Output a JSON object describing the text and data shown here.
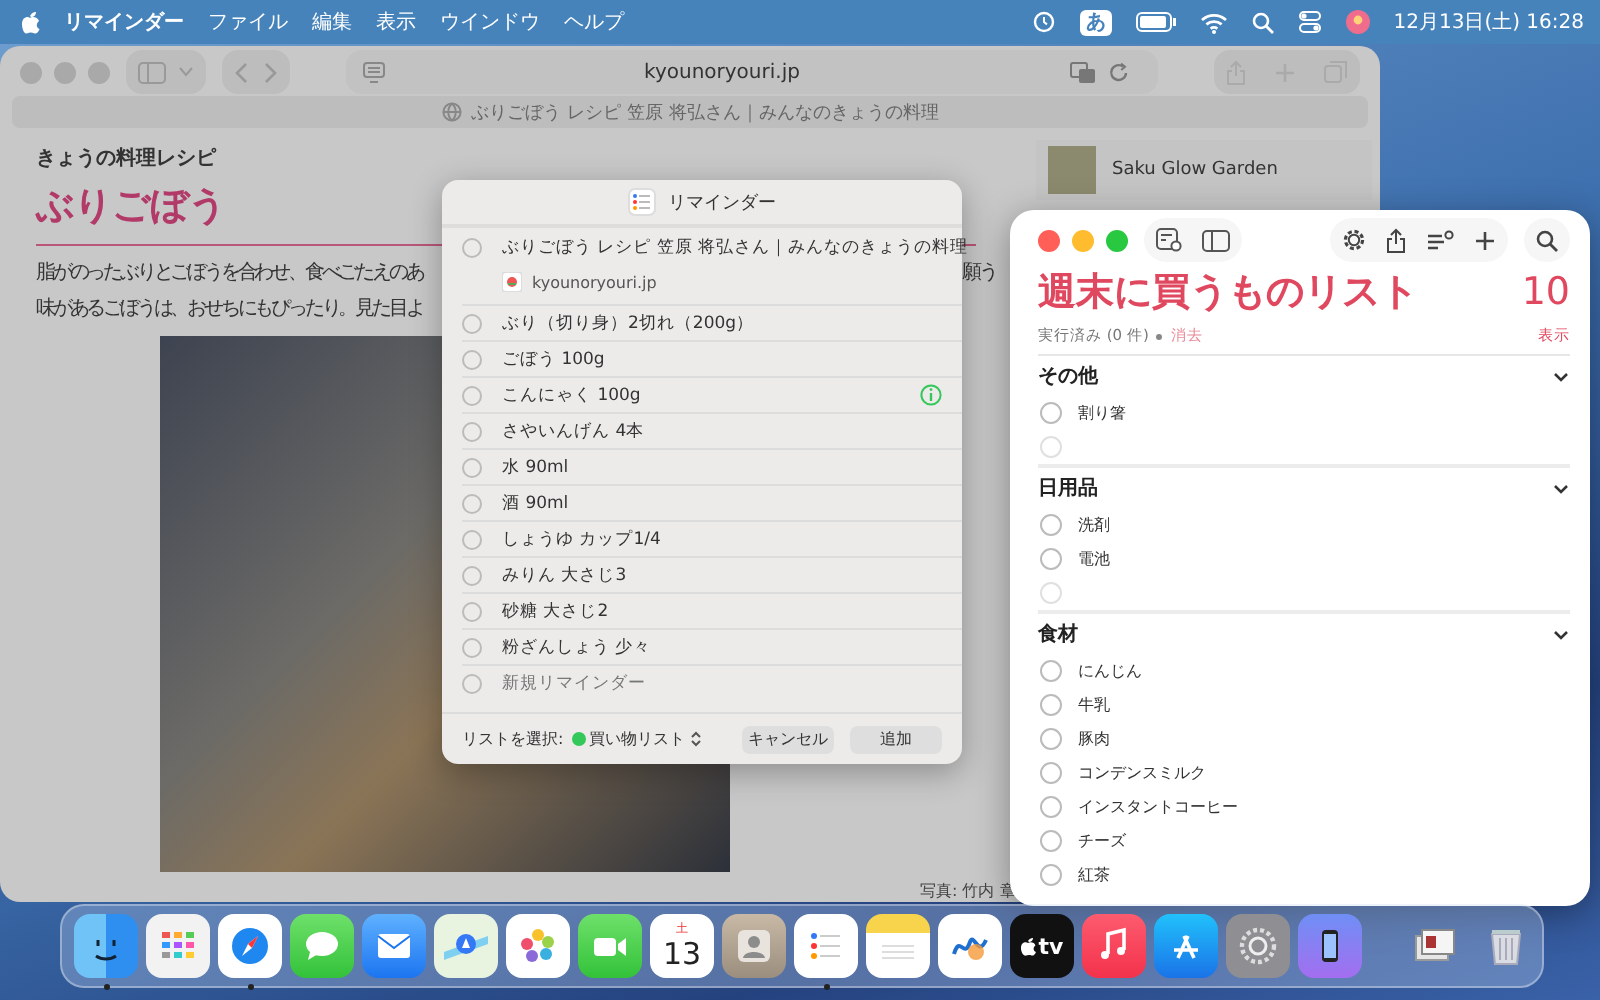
{
  "menu_bar": {
    "app_name": "リマインダー",
    "menus": [
      "ファイル",
      "編集",
      "表示",
      "ウインドウ",
      "ヘルプ"
    ],
    "input_mode": "あ",
    "clock": "12月13日(土) 16:28"
  },
  "browser": {
    "url": "kyounoryouri.jp",
    "tab_title": "ぶりごぼう レシピ 笠原 将弘さん｜みんなのきょうの料理",
    "page": {
      "category": "きょうの料理レシピ",
      "title": "ぶりごぼう",
      "intro_lines": [
        {
          "left": "脂がのったぶりとごぼうを合わせ、食べごたえのあ",
          "right": "願う"
        },
        {
          "left": "味があるごぼうは、おせちにもぴったり。見た目よ"
        }
      ],
      "ad_title": "Saku Glow Garden",
      "photo_credit": "写真: 竹内 章"
    }
  },
  "share_dialog": {
    "title": "リマインダー",
    "link": {
      "title": "ぶりごぼう レシピ 笠原 将弘さん｜みんなのきょうの料理",
      "site": "kyounoryouri.jp"
    },
    "items": [
      {
        "text": "ぶり（切り身）2切れ（200g）",
        "info": false
      },
      {
        "text": "ごぼう 100g",
        "info": false
      },
      {
        "text": "こんにゃく 100g",
        "info": true
      },
      {
        "text": "さやいんげん 4本",
        "info": false
      },
      {
        "text": "水 90ml",
        "info": false
      },
      {
        "text": "酒 90ml",
        "info": false
      },
      {
        "text": "しょうゆ カップ1/4",
        "info": false
      },
      {
        "text": "みりん 大さじ3",
        "info": false
      },
      {
        "text": "砂糖 大さじ2",
        "info": false
      },
      {
        "text": "粉ざんしょう 少々",
        "info": false
      }
    ],
    "new_item": {
      "placeholder": "新規リマインダー"
    },
    "list_label": "リストを選択:",
    "list_name": "買い物リスト",
    "buttons": [
      "キャンセル",
      "追加"
    ]
  },
  "reminders": {
    "title": "週末に買うものリスト",
    "count": "10",
    "completed": "実行済み (0 件)",
    "clear": "消去",
    "show": "表示",
    "sections": [
      {
        "name": "その他",
        "expanded": true,
        "items": [
          {
            "kind": "task",
            "text": "割り箸",
            "checked": false
          },
          {
            "kind": "new"
          }
        ]
      },
      {
        "name": "日用品",
        "expanded": true,
        "items": [
          {
            "kind": "task",
            "text": "洗剤",
            "checked": false
          },
          {
            "kind": "task",
            "text": "電池",
            "checked": false
          },
          {
            "kind": "new"
          }
        ]
      },
      {
        "name": "食材",
        "expanded": true,
        "items": [
          {
            "kind": "task",
            "text": "にんじん",
            "checked": false
          },
          {
            "kind": "task",
            "text": "牛乳",
            "checked": false
          },
          {
            "kind": "task",
            "text": "豚肉",
            "checked": false
          },
          {
            "kind": "task",
            "text": "コンデンスミルク",
            "checked": false
          },
          {
            "kind": "task",
            "text": "インスタントコーヒー",
            "checked": false
          },
          {
            "kind": "task",
            "text": "チーズ",
            "checked": false
          },
          {
            "kind": "task",
            "text": "紅茶",
            "checked": false
          }
        ]
      }
    ]
  },
  "dock": [
    {
      "kind": "finder",
      "running": true
    },
    {
      "kind": "launchpad",
      "running": false
    },
    {
      "kind": "safari",
      "running": true
    },
    {
      "kind": "messages",
      "running": false
    },
    {
      "kind": "mail",
      "running": false
    },
    {
      "kind": "maps",
      "running": false
    },
    {
      "kind": "photos",
      "running": false
    },
    {
      "kind": "facetime",
      "running": false
    },
    {
      "kind": "calendar",
      "running": false,
      "weekday": "土",
      "day": "13"
    },
    {
      "kind": "contacts",
      "running": false
    },
    {
      "kind": "reminders",
      "running": true
    },
    {
      "kind": "notes",
      "running": false
    },
    {
      "kind": "freeform",
      "running": false
    },
    {
      "kind": "tv",
      "running": false,
      "label": "tv"
    },
    {
      "kind": "music",
      "running": false
    },
    {
      "kind": "appstore",
      "running": false
    },
    {
      "kind": "settings",
      "running": false
    },
    {
      "kind": "phone",
      "running": false
    },
    {
      "kind": "separator"
    },
    {
      "kind": "downloads",
      "running": false
    },
    {
      "kind": "trash",
      "running": false
    }
  ]
}
